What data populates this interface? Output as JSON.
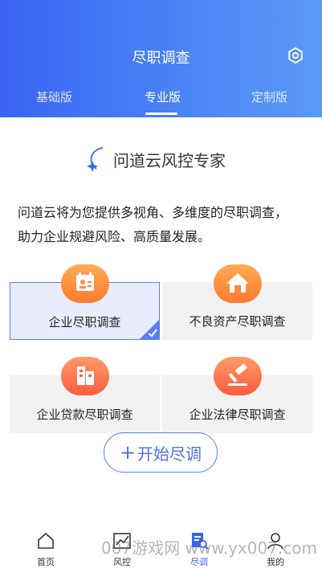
{
  "header": {
    "title": "尽职调查",
    "settings_icon": "gear-icon",
    "tabs": [
      {
        "label": "基础版",
        "active": false
      },
      {
        "label": "专业版",
        "active": true
      },
      {
        "label": "定制版",
        "active": false
      }
    ]
  },
  "brand": {
    "name": "问道云风控专家",
    "logo_icon": "star-swoosh-icon"
  },
  "intro": {
    "line1": "问道云将为您提供多视角、多维度的尽职调查，",
    "line2": "助力企业规避风险、高质量发展。"
  },
  "options": [
    {
      "label": "企业尽职调查",
      "icon": "calendar-person-icon",
      "selected": true
    },
    {
      "label": "不良资产尽职调查",
      "icon": "house-icon",
      "selected": false
    },
    {
      "label": "企业贷款尽职调查",
      "icon": "building-icon",
      "selected": false
    },
    {
      "label": "企业法律尽职调查",
      "icon": "gavel-icon",
      "selected": false
    }
  ],
  "start_button": {
    "plus": "+",
    "label": "开始尽调"
  },
  "bottom_nav": [
    {
      "label": "首页",
      "icon": "home-icon",
      "active": false
    },
    {
      "label": "风控",
      "icon": "chart-icon",
      "active": false
    },
    {
      "label": "尽调",
      "icon": "document-search-icon",
      "active": true
    },
    {
      "label": "我的",
      "icon": "user-icon",
      "active": false
    }
  ],
  "watermark": "007游戏网 www.yx007.com",
  "colors": {
    "primary": "#3a63f2",
    "accent_orange": "#ff8a3d",
    "card_bg": "#f2f2f2"
  }
}
